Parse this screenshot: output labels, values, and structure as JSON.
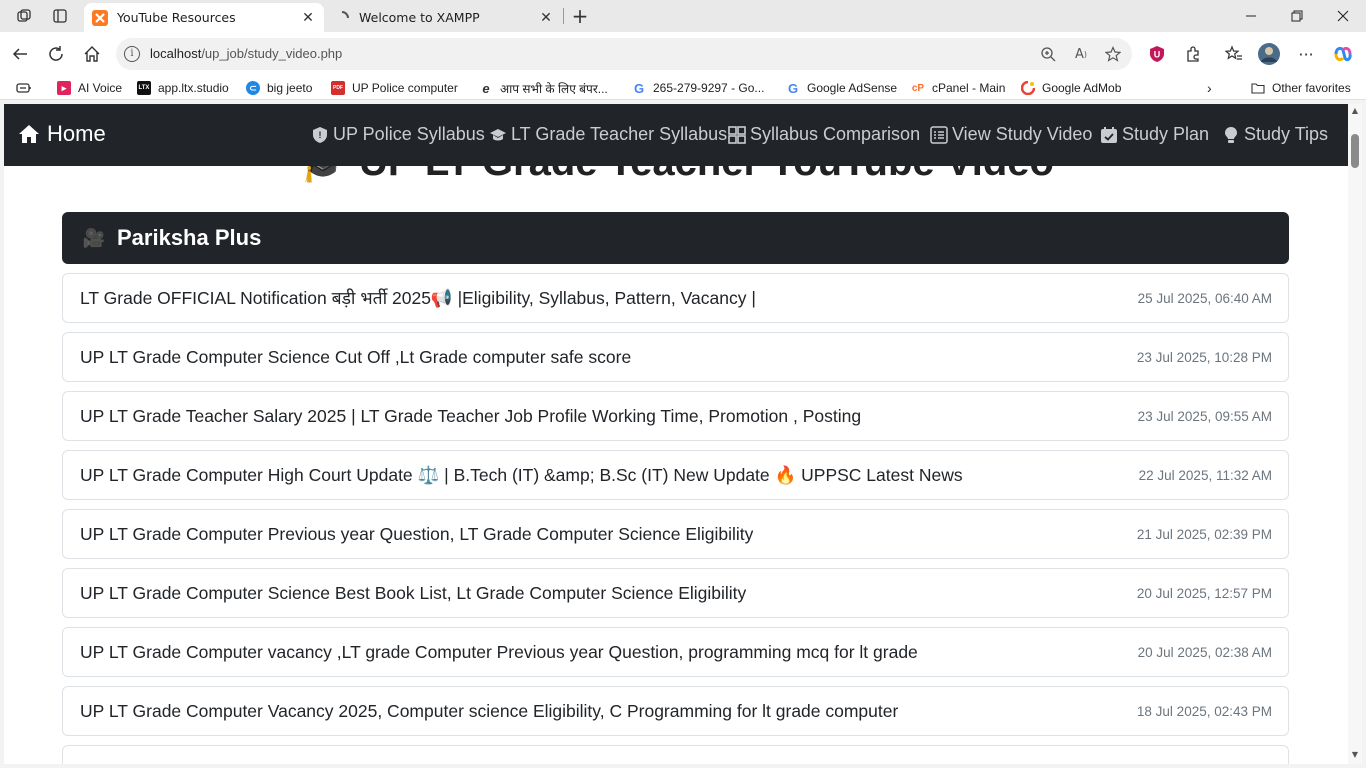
{
  "browser": {
    "tabs": [
      {
        "title": "YouTube Resources",
        "active": true
      },
      {
        "title": "Welcome to XAMPP",
        "active": false
      }
    ],
    "url_host": "localhost",
    "url_path": "/up_job/study_video.php",
    "favorites": [
      {
        "label": "AI Voice",
        "icon": "ai-voice-icon",
        "color": "#e0245e"
      },
      {
        "label": "app.ltx.studio",
        "icon": "ltx-icon",
        "color": "#111111"
      },
      {
        "label": "big jeeto",
        "icon": "big-jeeto-icon",
        "color": "#1e88e5"
      },
      {
        "label": "UP Police computer",
        "icon": "pdf-icon",
        "color": "#d32f2f"
      },
      {
        "label": "आप सभी के लिए बंपर...",
        "icon": "e-icon",
        "color": "#333333"
      },
      {
        "label": "265-279-9297 - Go...",
        "icon": "google-icon",
        "color": "#4285f4"
      },
      {
        "label": "Google AdSense",
        "icon": "google-icon",
        "color": "#4285f4"
      },
      {
        "label": "cPanel - Main",
        "icon": "cpanel-icon",
        "color": "#ff6c2c"
      },
      {
        "label": "Google AdMob",
        "icon": "admob-icon",
        "color": "#ea4335"
      }
    ],
    "other_favorites": "Other favorites"
  },
  "site": {
    "brand": "Home",
    "nav": [
      {
        "label": "UP Police Syllabus",
        "icon": "shield-icon"
      },
      {
        "label": "LT Grade Teacher Syllabus",
        "icon": "graduation-cap-icon"
      },
      {
        "label": "Syllabus Comparison",
        "icon": "columns-icon"
      },
      {
        "label": "View Study Video",
        "icon": "list-icon"
      },
      {
        "label": "Study Plan",
        "icon": "calendar-icon"
      },
      {
        "label": "Study Tips",
        "icon": "lightbulb-icon"
      }
    ],
    "heading": "UP LT Grade Teacher YouTube Video",
    "channel": "Pariksha Plus",
    "videos": [
      {
        "title": "LT Grade OFFICIAL Notification बड़ी भर्ती 2025📢 |Eligibility, Syllabus, Pattern, Vacancy |",
        "date": "25 Jul 2025, 06:40 AM"
      },
      {
        "title": "UP LT Grade Computer Science Cut Off ,Lt Grade computer safe score",
        "date": "23 Jul 2025, 10:28 PM"
      },
      {
        "title": "UP LT Grade Teacher Salary 2025 | LT Grade Teacher Job Profile Working Time, Promotion , Posting",
        "date": "23 Jul 2025, 09:55 AM"
      },
      {
        "title": "UP LT Grade Computer High Court Update ⚖️ | B.Tech (IT) &amp; B.Sc (IT) New Update 🔥 UPPSC Latest News",
        "date": "22 Jul 2025, 11:32 AM"
      },
      {
        "title": "UP LT Grade Computer Previous year Question, LT Grade Computer Science Eligibility",
        "date": "21 Jul 2025, 02:39 PM"
      },
      {
        "title": "UP LT Grade Computer Science Best Book List, Lt Grade Computer Science Eligibility",
        "date": "20 Jul 2025, 12:57 PM"
      },
      {
        "title": "UP LT Grade Computer vacancy ,LT grade Computer Previous year Question, programming mcq for lt grade",
        "date": "20 Jul 2025, 02:38 AM"
      },
      {
        "title": "UP LT Grade Computer Vacancy 2025, Computer science Eligibility, C Programming for lt grade computer",
        "date": "18 Jul 2025, 02:43 PM"
      },
      {
        "title": "",
        "date": ""
      }
    ]
  }
}
